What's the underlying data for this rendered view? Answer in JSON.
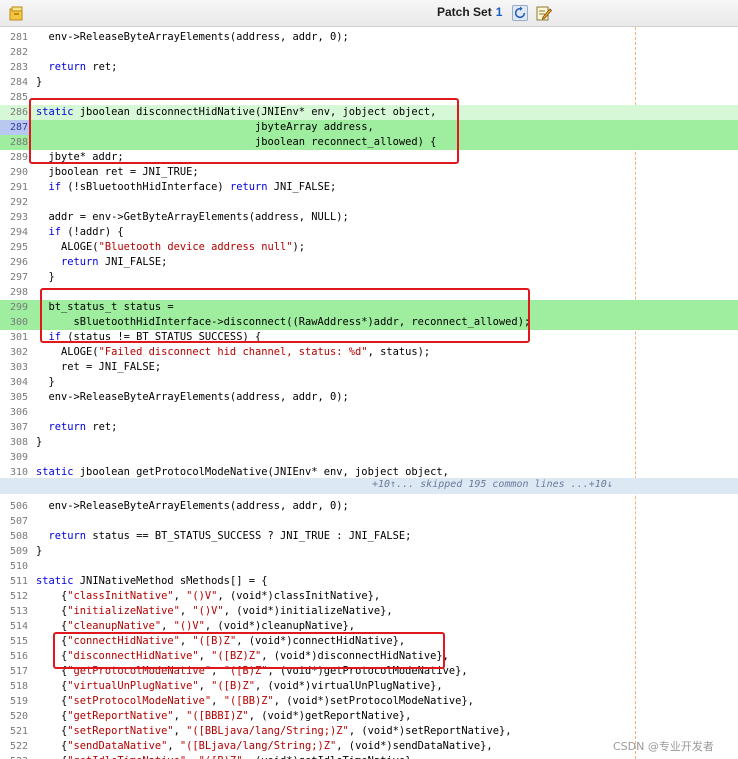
{
  "toolbar": {
    "title": "Patch Set",
    "count": "1",
    "icons": [
      "patch-app-icon",
      "refresh-icon",
      "edit-icon"
    ]
  },
  "colors": {
    "changed_line": "#9fee9f",
    "current_line_gutter": "#b8c8f0",
    "keyword": "#0000e0",
    "string": "#b40000",
    "highlight_box": "#e0181e",
    "fold_band": "#dce8f4"
  },
  "fold": {
    "label": "+10↑... skipped 195 common lines ...+10↓"
  },
  "watermark": "CSDN @专业开发者",
  "lines": [
    {
      "n": "281",
      "t": "  env->ReleaseByteArrayElements(address, addr, 0);"
    },
    {
      "n": "282",
      "t": ""
    },
    {
      "n": "283",
      "t": "  return ret;"
    },
    {
      "n": "284",
      "t": "}"
    },
    {
      "n": "285",
      "t": ""
    },
    {
      "n": "286",
      "t": "static jboolean disconnectHidNative(JNIEnv* env, jobject object,"
    },
    {
      "n": "287",
      "t": "                                   jbyteArray address,"
    },
    {
      "n": "288",
      "t": "                                   jboolean reconnect_allowed) {"
    },
    {
      "n": "289",
      "t": "  jbyte* addr;"
    },
    {
      "n": "290",
      "t": "  jboolean ret = JNI_TRUE;"
    },
    {
      "n": "291",
      "t": "  if (!sBluetoothHidInterface) return JNI_FALSE;"
    },
    {
      "n": "292",
      "t": ""
    },
    {
      "n": "293",
      "t": "  addr = env->GetByteArrayElements(address, NULL);"
    },
    {
      "n": "294",
      "t": "  if (!addr) {"
    },
    {
      "n": "295",
      "t": "    ALOGE(\"Bluetooth device address null\");"
    },
    {
      "n": "296",
      "t": "    return JNI_FALSE;"
    },
    {
      "n": "297",
      "t": "  }"
    },
    {
      "n": "298",
      "t": ""
    },
    {
      "n": "299",
      "t": "  bt_status_t status ="
    },
    {
      "n": "300",
      "t": "      sBluetoothHidInterface->disconnect((RawAddress*)addr, reconnect_allowed);"
    },
    {
      "n": "301",
      "t": "  if (status != BT_STATUS_SUCCESS) {"
    },
    {
      "n": "302",
      "t": "    ALOGE(\"Failed disconnect hid channel, status: %d\", status);"
    },
    {
      "n": "303",
      "t": "    ret = JNI_FALSE;"
    },
    {
      "n": "304",
      "t": "  }"
    },
    {
      "n": "305",
      "t": "  env->ReleaseByteArrayElements(address, addr, 0);"
    },
    {
      "n": "306",
      "t": ""
    },
    {
      "n": "307",
      "t": "  return ret;"
    },
    {
      "n": "308",
      "t": "}"
    },
    {
      "n": "309",
      "t": ""
    },
    {
      "n": "310",
      "t": "static jboolean getProtocolModeNative(JNIEnv* env, jobject object,"
    },
    {
      "n": "506",
      "t": "  env->ReleaseByteArrayElements(address, addr, 0);"
    },
    {
      "n": "507",
      "t": ""
    },
    {
      "n": "508",
      "t": "  return status == BT_STATUS_SUCCESS ? JNI_TRUE : JNI_FALSE;"
    },
    {
      "n": "509",
      "t": "}"
    },
    {
      "n": "510",
      "t": ""
    },
    {
      "n": "511",
      "t": "static JNINativeMethod sMethods[] = {"
    },
    {
      "n": "512",
      "t": "    {\"classInitNative\", \"()V\", (void*)classInitNative},"
    },
    {
      "n": "513",
      "t": "    {\"initializeNative\", \"()V\", (void*)initializeNative},"
    },
    {
      "n": "514",
      "t": "    {\"cleanupNative\", \"()V\", (void*)cleanupNative},"
    },
    {
      "n": "515",
      "t": "    {\"connectHidNative\", \"([B)Z\", (void*)connectHidNative},"
    },
    {
      "n": "516",
      "t": "    {\"disconnectHidNative\", \"([BZ)Z\", (void*)disconnectHidNative},"
    },
    {
      "n": "517",
      "t": "    {\"getProtocolModeNative\", \"([B)Z\", (void*)getProtocolModeNative},"
    },
    {
      "n": "518",
      "t": "    {\"virtualUnPlugNative\", \"([B)Z\", (void*)virtualUnPlugNative},"
    },
    {
      "n": "519",
      "t": "    {\"setProtocolModeNative\", \"([BB)Z\", (void*)setProtocolModeNative},"
    },
    {
      "n": "520",
      "t": "    {\"getReportNative\", \"([BBBI)Z\", (void*)getReportNative},"
    },
    {
      "n": "521",
      "t": "    {\"setReportNative\", \"([BBLjava/lang/String;)Z\", (void*)setReportNative},"
    },
    {
      "n": "522",
      "t": "    {\"sendDataNative\", \"([BLjava/lang/String;)Z\", (void*)sendDataNative},"
    },
    {
      "n": "523",
      "t": "    {\"getIdleTimeNative\", \"([B)Z\", (void*)getIdleTimeNative},"
    }
  ]
}
